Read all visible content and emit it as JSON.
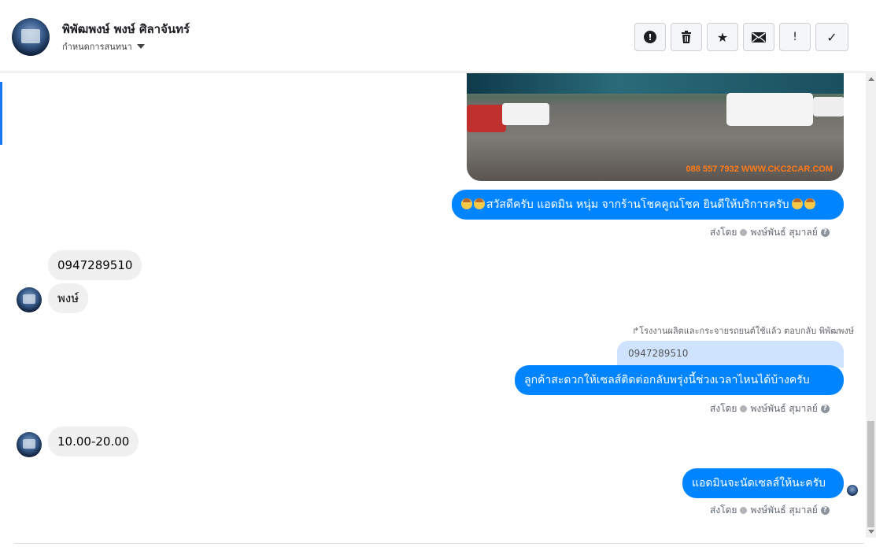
{
  "header": {
    "contact_name": "พิพัฒพงษ์ พงษ์ ศิลาจันทร์",
    "subtitle": "กำหนดการสนทนา",
    "toolbar": [
      {
        "icon": "alert-circle-icon",
        "glyph": "!"
      },
      {
        "icon": "trash-icon",
        "glyph": "🗑"
      },
      {
        "icon": "star-icon",
        "glyph": "★"
      },
      {
        "icon": "envelope-icon",
        "glyph": "✉"
      },
      {
        "icon": "exclamation-icon",
        "glyph": "!"
      },
      {
        "icon": "checkmark-icon",
        "glyph": "✓"
      }
    ]
  },
  "thread": {
    "photo_watermark": "088 557 7932 WWW.CKC2CAR.COM",
    "messages": [
      {
        "from": "page",
        "text": "สวัสดีครับ แอดมิน หนุ่ม จากร้านโชคคูณโชค ยินดีให้บริการครับ"
      },
      {
        "meta": "ส่งโดย",
        "sender": "พงษ์พันธ์ สุมาลย์"
      },
      {
        "from": "user",
        "text": "0947289510"
      },
      {
        "from": "user",
        "text": "พงษ์"
      },
      {
        "reply_note": "โรงงานผลิตและกระจายรถยนต์ใช้แล้ว ตอบกลับ พิพัฒพงษ์",
        "quoted": "0947289510"
      },
      {
        "from": "page",
        "text": "ลูกค้าสะดวกให้เซลส์ติดต่อกลับพรุ่งนี้ช่วงเวลาไหนได้บ้างครับ"
      },
      {
        "meta": "ส่งโดย",
        "sender": "พงษ์พันธ์ สุมาลย์"
      },
      {
        "from": "user",
        "text": "10.00-20.00"
      },
      {
        "from": "page",
        "text": "แอดมินจะนัดเซลส์ให้นะครับ"
      },
      {
        "meta": "ส่งโดย",
        "sender": "พงษ์พันธ์ สุมาลย์"
      }
    ]
  },
  "colors": {
    "bubble_out": "#0084ff",
    "bubble_in": "#f0f0f0",
    "accent": "#1877f2"
  }
}
